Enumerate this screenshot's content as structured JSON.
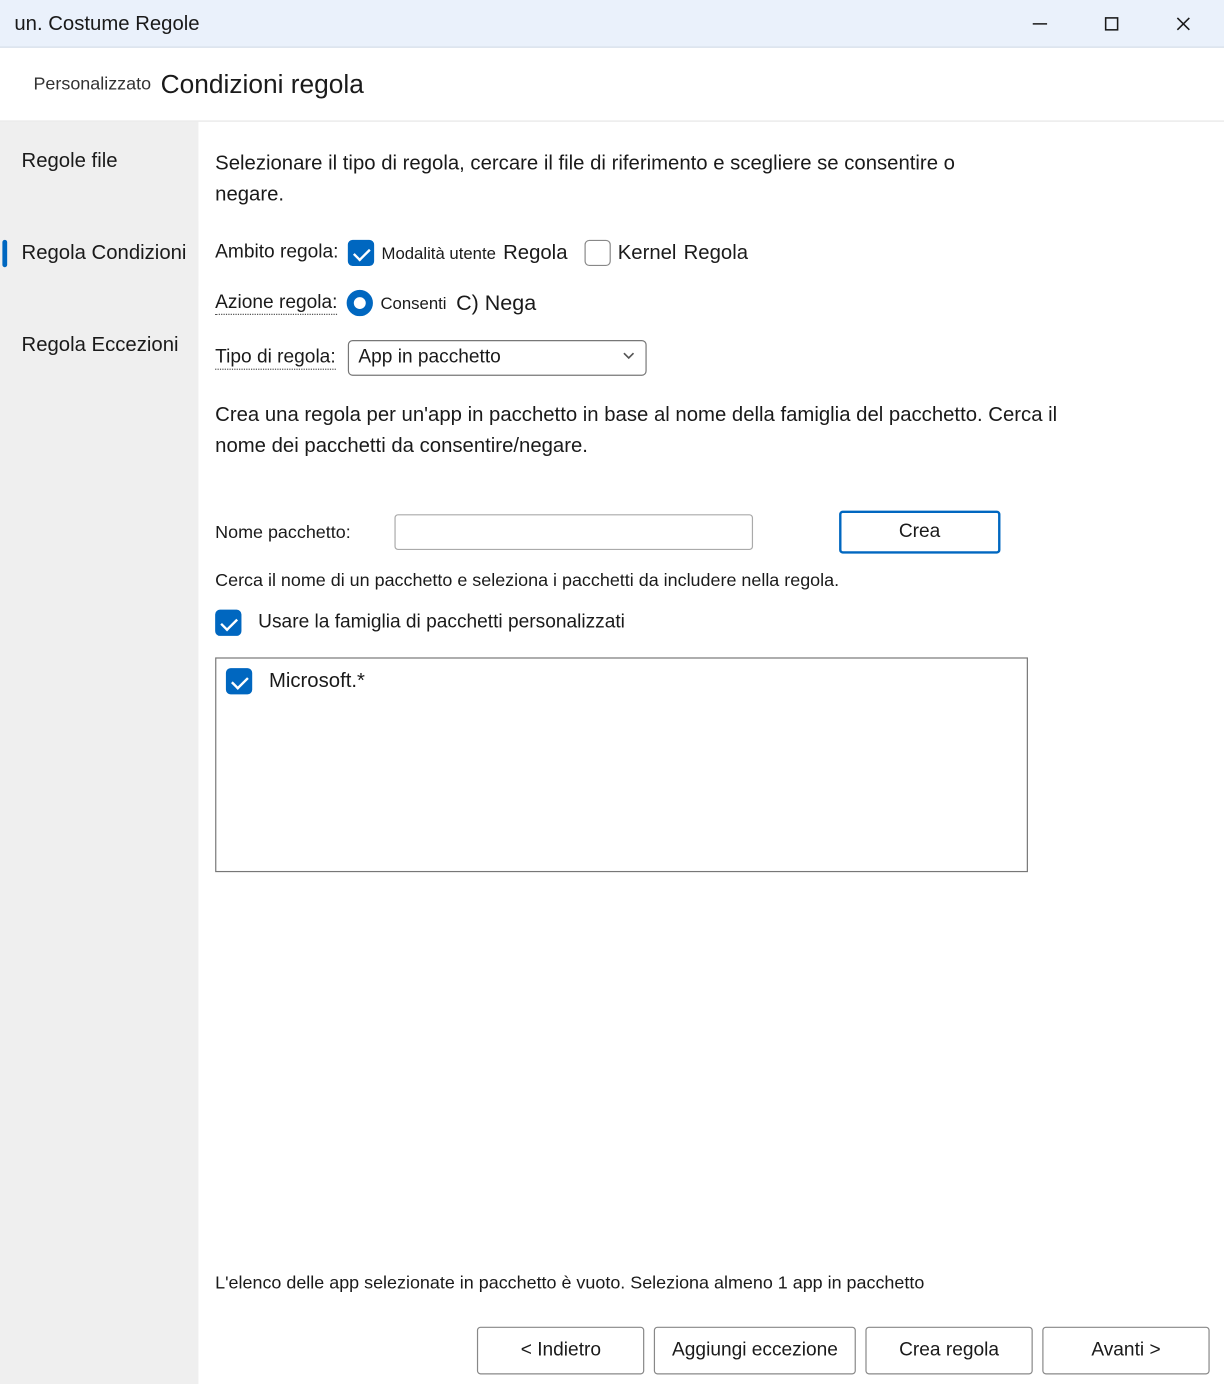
{
  "titlebar": {
    "title": "un. Costume  Regole"
  },
  "header": {
    "crumb": "Personalizzato",
    "page_title": "Condizioni regola"
  },
  "sidebar": {
    "items": [
      {
        "label": "Regole file"
      },
      {
        "label": "Regola Condizioni"
      },
      {
        "label": "Regola Eccezioni"
      }
    ]
  },
  "main": {
    "intro": "Selezionare il tipo di regola, cercare il file di riferimento e scegliere se consentire o negare.",
    "scope_label": "Ambito regola:",
    "scope_user_small": "Modalità utente",
    "scope_user_after": "Regola",
    "scope_kernel": "Kernel",
    "scope_kernel_after": "Regola",
    "action_label": "Azione regola:",
    "action_allow": "Consenti",
    "action_deny": "C) Nega",
    "type_label": "Tipo di regola:",
    "type_value": "App in pacchetto",
    "type_desc": "Crea una regola per un'app in pacchetto in base al nome della famiglia del pacchetto. Cerca il nome dei pacchetti da consentire/negare.",
    "pkg_label": "Nome pacchetto:",
    "create_btn": "Crea",
    "search_hint": "Cerca il nome di un pacchetto e seleziona i pacchetti da includere nella regola.",
    "custom_family": "Usare la famiglia di pacchetti personalizzati",
    "list_items": [
      {
        "label": "Microsoft.*",
        "checked": true
      }
    ],
    "status": "L'elenco delle app selezionate in pacchetto è vuoto. Seleziona almeno 1 app in pacchetto"
  },
  "footer": {
    "back": "<  Indietro",
    "add_exception": "Aggiungi eccezione",
    "create_rule": "Crea regola",
    "next": "Avanti >"
  }
}
